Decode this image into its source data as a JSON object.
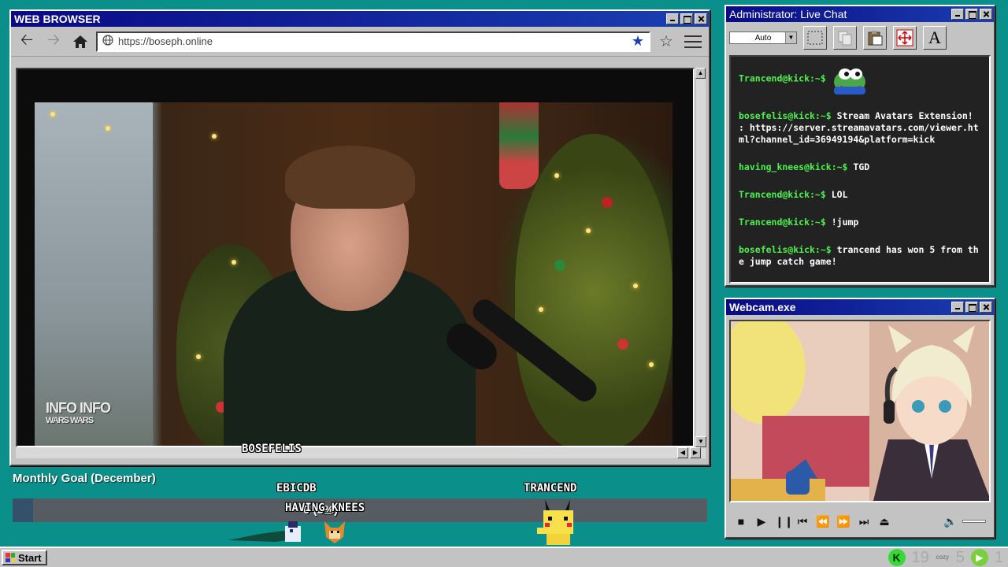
{
  "browser": {
    "title": "WEB BROWSER",
    "url": "https://boseph.online",
    "overlay_name": "BOSEFELIS",
    "watermark_line1": "INFO INFO",
    "watermark_line2": "WARS WARS"
  },
  "goal": {
    "title": "Monthly Goal (December)",
    "progress_text": "0 (3%)",
    "progress_percent": 3
  },
  "avatars": [
    {
      "name": "EBICDB"
    },
    {
      "name": "HAVING_KNEES"
    },
    {
      "name": "TRANCEND"
    }
  ],
  "chat": {
    "title": "Administrator: Live Chat",
    "select_value": "Auto",
    "font_tool": "A",
    "messages": [
      {
        "user": "Trancend@kick:~$",
        "text": ""
      },
      {
        "user": "bosefelis@kick:~$",
        "text": "Stream Avatars Extension! : https://server.streamavatars.com/viewer.html?channel_id=36949194&platform=kick"
      },
      {
        "user": "having_knees@kick:~$",
        "text": "TGD"
      },
      {
        "user": "Trancend@kick:~$",
        "text": "LOL"
      },
      {
        "user": "Trancend@kick:~$",
        "text": "!jump"
      },
      {
        "user": "bosefelis@kick:~$",
        "text": "trancend has won 5 from the jump catch game!"
      }
    ]
  },
  "webcam": {
    "title": "Webcam.exe"
  },
  "taskbar": {
    "start_label": "Start",
    "kick_letter": "K",
    "count_a": "19",
    "cozy_label": "cozy",
    "count_b": "5",
    "count_c": "1"
  },
  "colors": {
    "desktop": "#0b8f8a",
    "titlebar": "#0a0a86",
    "chat_user": "#4cf24c",
    "kick_green": "#36d936"
  }
}
